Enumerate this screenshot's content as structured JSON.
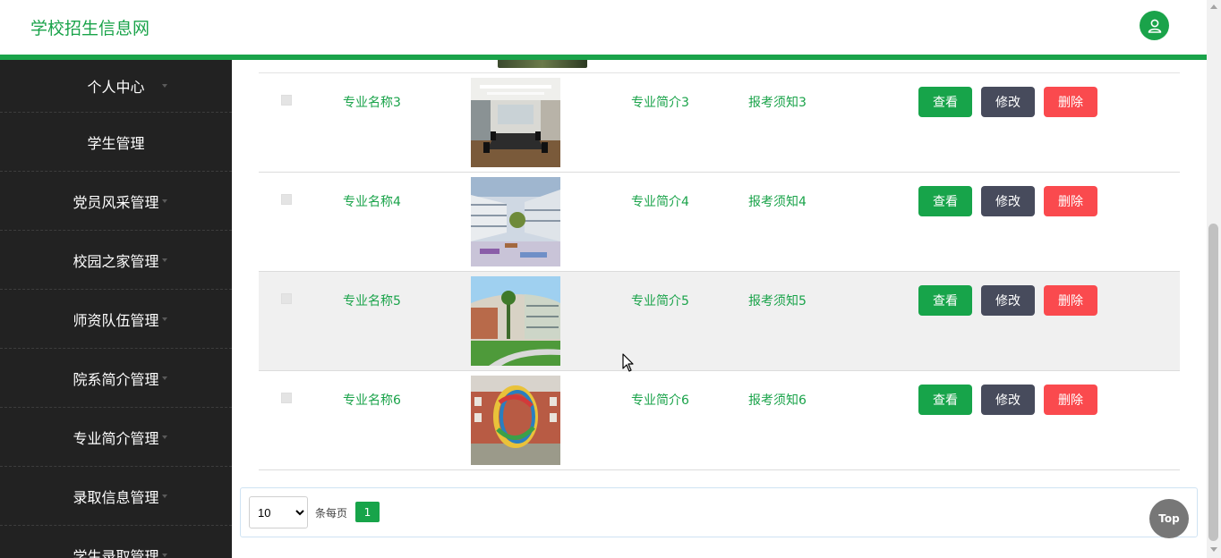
{
  "header": {
    "title": "学校招生信息网",
    "user_icon": "user-icon",
    "accent": "#1aa34a"
  },
  "sidebar": {
    "items": [
      {
        "label": "个人中心"
      },
      {
        "label": "学生管理"
      },
      {
        "label": "党员风采管理"
      },
      {
        "label": "校园之家管理"
      },
      {
        "label": "师资队伍管理"
      },
      {
        "label": "院系简介管理"
      },
      {
        "label": "专业简介管理"
      },
      {
        "label": "录取信息管理"
      },
      {
        "label": "学生录取管理"
      }
    ]
  },
  "table": {
    "rows": [
      {
        "name": "专业名称3",
        "intro": "专业简介3",
        "notice": "报考须知3",
        "image": "meeting-room-photo"
      },
      {
        "name": "专业名称4",
        "intro": "专业简介4",
        "notice": "报考须知4",
        "image": "campus-courtyard-photo"
      },
      {
        "name": "专业名称5",
        "intro": "专业简介5",
        "notice": "报考须知5",
        "image": "curved-building-photo"
      },
      {
        "name": "专业名称6",
        "intro": "专业简介6",
        "notice": "报考须知6",
        "image": "ring-sculpture-photo"
      }
    ],
    "actions": {
      "view": "查看",
      "edit": "修改",
      "delete": "删除"
    }
  },
  "pagination": {
    "page_size": "10",
    "per_page_label": "条每页",
    "current_page": "1"
  },
  "top_button": "Top",
  "colors": {
    "green": "#17a44a",
    "dark": "#474b5c",
    "red": "#fa4a4e",
    "sidebar": "#222222"
  }
}
